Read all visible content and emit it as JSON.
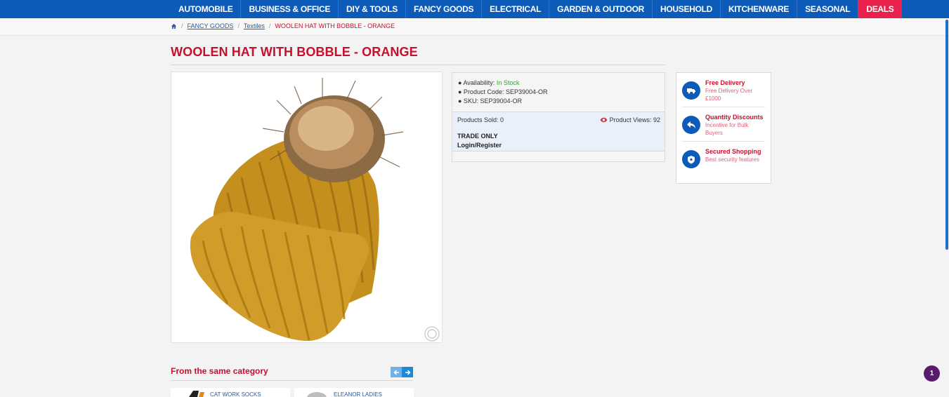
{
  "nav": {
    "items": [
      "AUTOMOBILE",
      "BUSINESS & OFFICE",
      "DIY & TOOLS",
      "FANCY GOODS",
      "ELECTRICAL",
      "GARDEN & OUTDOOR",
      "HOUSEHOLD",
      "KITCHENWARE",
      "SEASONAL",
      "DEALS"
    ],
    "deals_color": "#e8224d",
    "bar_color": "#0c5bb9"
  },
  "breadcrumb": {
    "home_icon": "home-icon",
    "sep": "/",
    "items": [
      "FANCY GOODS",
      "Textiles"
    ],
    "current": "WOOLEN HAT WITH BOBBLE - ORANGE"
  },
  "product": {
    "title": "WOOLEN HAT WITH BOBBLE - ORANGE",
    "availability_label": "● Availability:",
    "availability_value": "In Stock",
    "code_line": "● Product Code: SEP39004-OR",
    "sku_line": "● SKU: SEP39004-OR",
    "sold": "Products Sold: 0",
    "views": "Product Views: 92",
    "trade_only": "TRADE ONLY",
    "login_register": "Login/Register"
  },
  "features": [
    {
      "title": "Free Delivery",
      "desc": "Free Delivery Over £1000",
      "icon": "truck-icon"
    },
    {
      "title": "Quantity Discounts",
      "desc": "Incentive for Bulk Buyers",
      "icon": "reply-icon"
    },
    {
      "title": "Secured Shopping",
      "desc": "Best security features",
      "icon": "shield-icon"
    }
  ],
  "related": {
    "title": "From the same category",
    "cards": [
      "CAT WORK SOCKS",
      "ELEANOR LADIES"
    ]
  },
  "badge": "1",
  "colors": {
    "accent_red": "#c8102e",
    "brand_blue": "#0c5bb9",
    "in_stock_green": "#2ea43a"
  }
}
